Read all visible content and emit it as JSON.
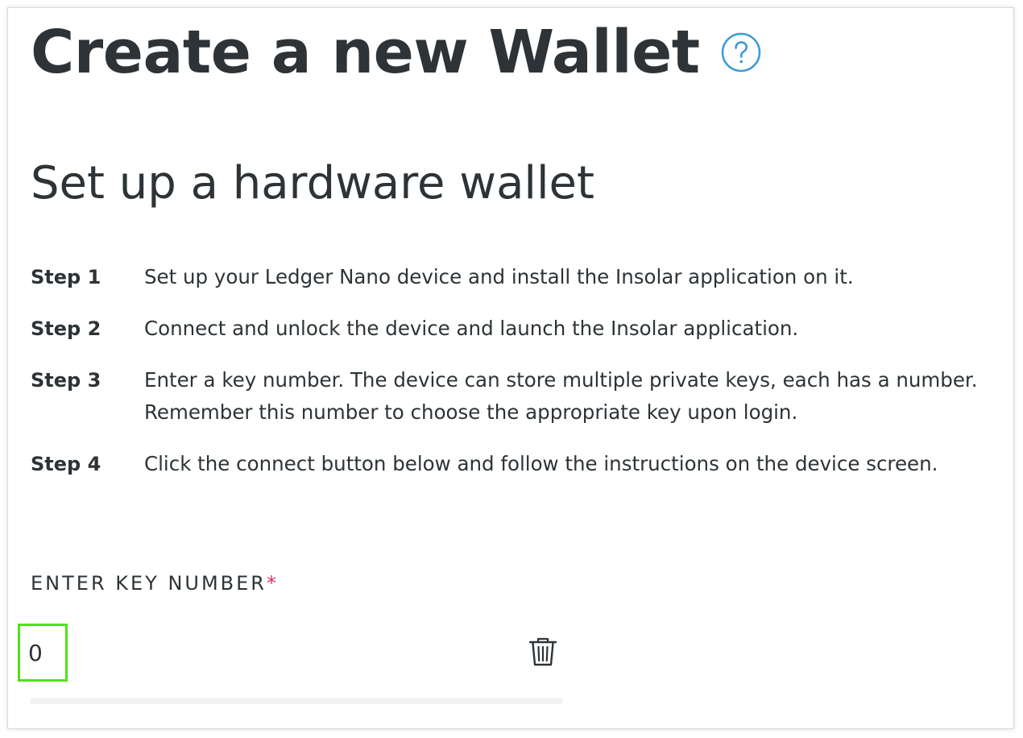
{
  "header": {
    "title": "Create a new Wallet",
    "help_icon": "question-circle-icon",
    "accent_color": "#3a9ad9"
  },
  "section": {
    "title": "Set up a hardware wallet"
  },
  "steps": [
    {
      "label": "Step 1",
      "text": "Set up your Ledger Nano device and install the Insolar application on it."
    },
    {
      "label": "Step 2",
      "text": "Connect and unlock the device and launch the Insolar application."
    },
    {
      "label": "Step 3",
      "text": "Enter a key number. The device can store multiple private keys, each has a number. Remember this number to choose the appropriate key upon login."
    },
    {
      "label": "Step 4",
      "text": "Click the connect button below and follow the instructions on the device screen."
    }
  ],
  "key_field": {
    "label": "ENTER KEY NUMBER",
    "required_marker": "*",
    "value": "0",
    "highlight_color": "#52e01a",
    "required_color": "#d6336c",
    "clear_icon": "trash-icon"
  }
}
